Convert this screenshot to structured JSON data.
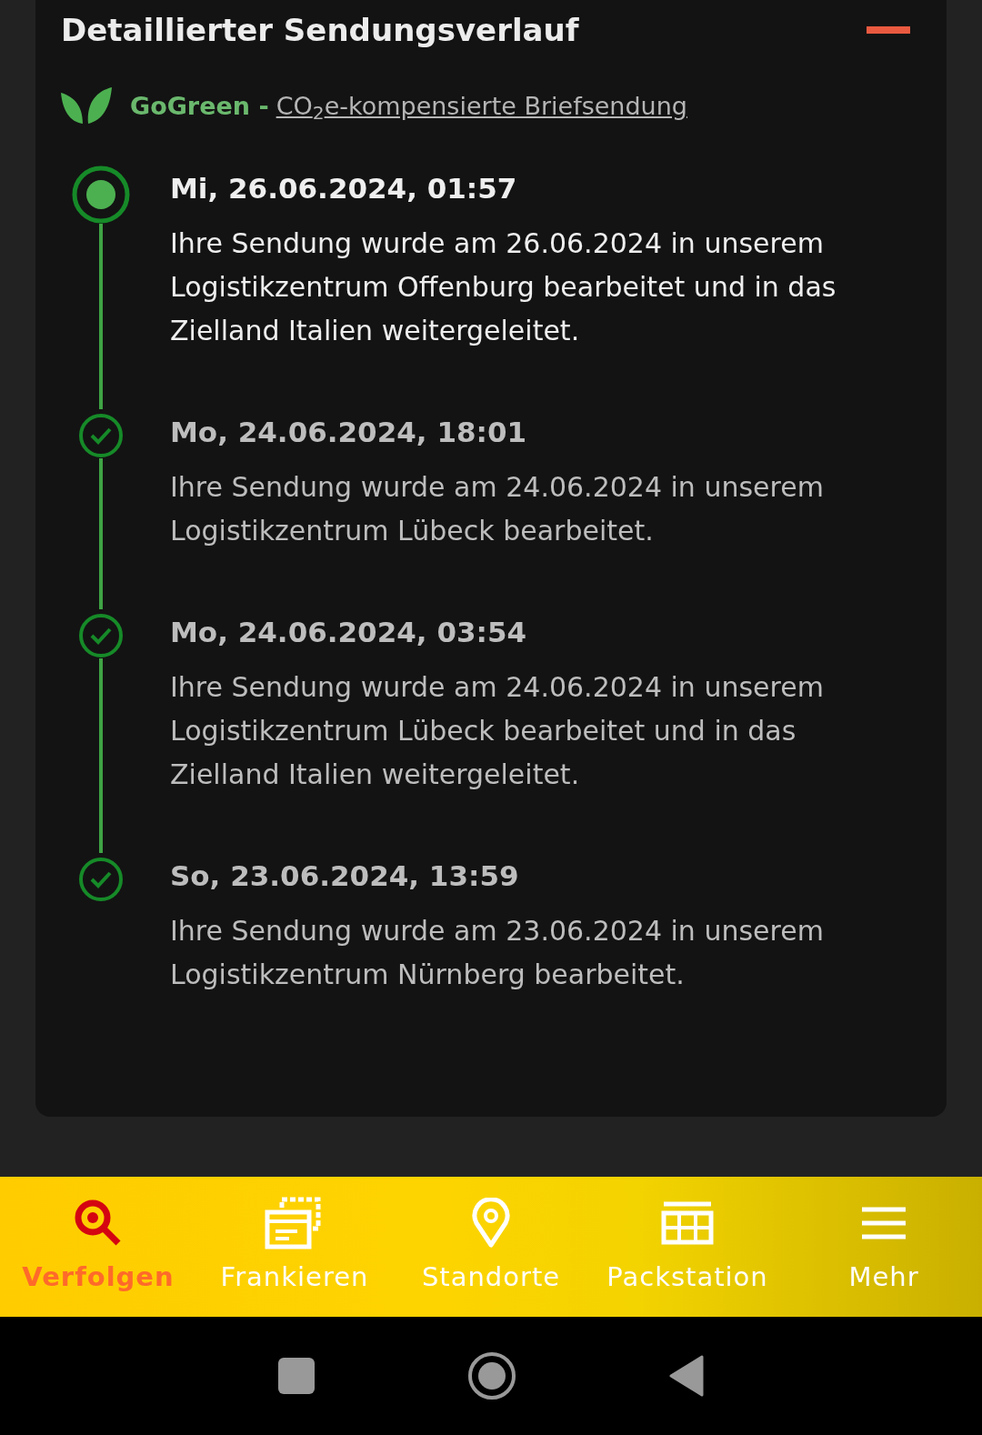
{
  "section": {
    "title": "Detaillierter Sendungsverlauf",
    "expanded": true
  },
  "gogreen": {
    "label": "GoGreen -",
    "link": "CO$_{2}$e-kompensierte Briefsendung"
  },
  "events": [
    {
      "kind": "current",
      "date": "Mi, 26.06.2024, 01:57",
      "text": "Ihre Sendung wurde am 26.06.2024 in unserem Logistikzentrum Offenburg bearbeitet und in das Zielland Italien weitergeleitet."
    },
    {
      "kind": "done",
      "date": "Mo, 24.06.2024, 18:01",
      "text": "Ihre Sendung wurde am 24.06.2024 in unserem Logistikzentrum Lübeck bearbeitet."
    },
    {
      "kind": "done",
      "date": "Mo, 24.06.2024, 03:54",
      "text": "Ihre Sendung wurde am 24.06.2024 in unserem Logistikzentrum Lübeck bearbeitet und in das Zielland Italien weitergeleitet."
    },
    {
      "kind": "done",
      "date": "So, 23.06.2024, 13:59",
      "text": "Ihre Sendung wurde am 23.06.2024 in unserem Logistikzentrum Nürnberg bearbeitet."
    }
  ],
  "nav": [
    {
      "kind": "search",
      "label": "Verfolgen",
      "selected": true
    },
    {
      "kind": "stamp",
      "label": "Frankieren",
      "selected": false
    },
    {
      "kind": "pin",
      "label": "Standorte",
      "selected": false
    },
    {
      "kind": "grid",
      "label": "Packstation",
      "selected": false
    },
    {
      "kind": "menu",
      "label": "Mehr",
      "selected": false
    }
  ]
}
